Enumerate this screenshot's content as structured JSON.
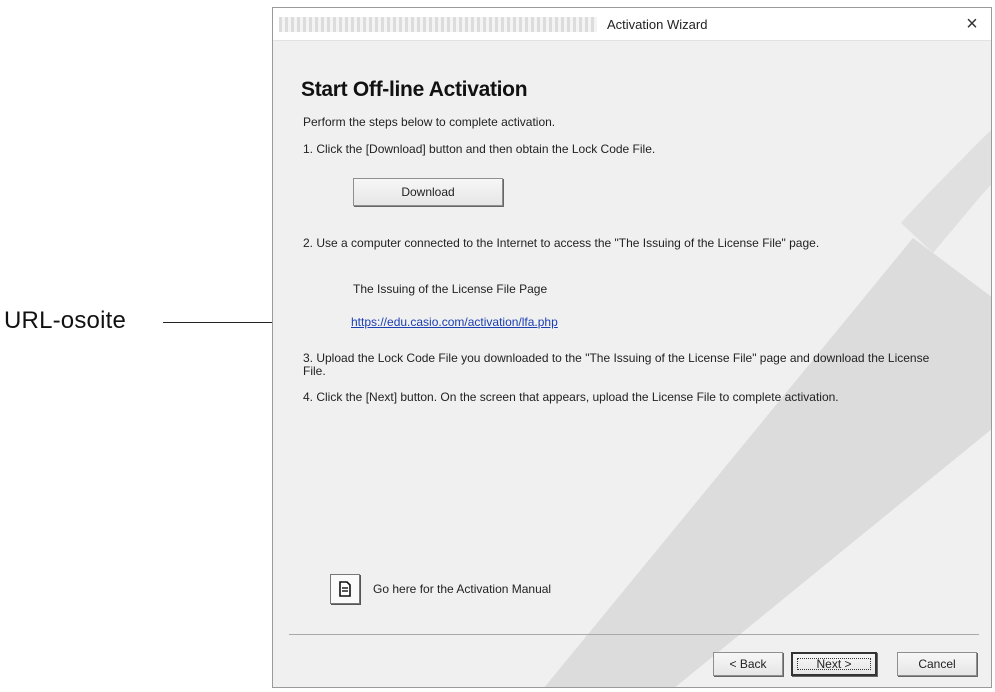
{
  "callout": {
    "label": "URL-osoite"
  },
  "window": {
    "title": "Activation Wizard",
    "close_glyph": "×"
  },
  "page": {
    "heading": "Start Off-line Activation",
    "intro": "Perform the steps below to complete activation.",
    "step1": "1. Click the [Download] button and then obtain the Lock Code File.",
    "download_label": "Download",
    "step2": "2. Use a computer connected to the Internet to access the \"The Issuing of the License File\" page.",
    "license_page_label": "The Issuing of the License File Page",
    "license_url": "https://edu.casio.com/activation/lfa.php",
    "step3_line1": "3. Upload the Lock Code File you downloaded to the \"The Issuing of the License File\" page and download the License",
    "step3_line2": "File.",
    "step4": "4. Click the [Next] button. On the screen that appears, upload the License File to complete activation.",
    "manual_text": "Go here for the Activation Manual",
    "manual_icon": "document-icon"
  },
  "footer": {
    "back_label": "< Back",
    "next_label": "Next >",
    "cancel_label": "Cancel"
  },
  "colors": {
    "link": "#1a3fb0",
    "watermark": "#d8d8d8"
  }
}
